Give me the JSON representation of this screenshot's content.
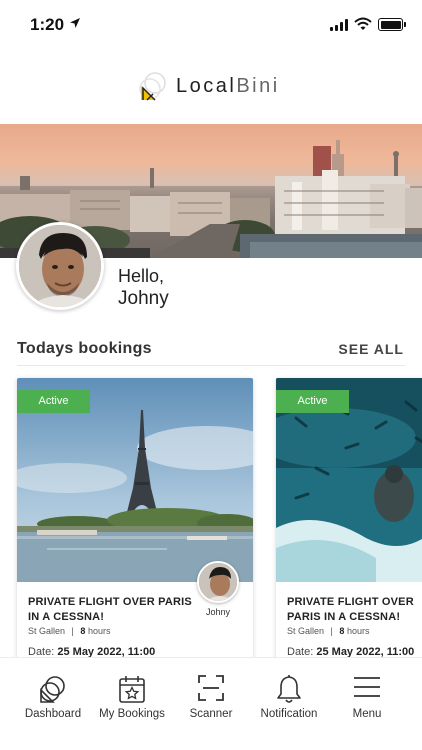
{
  "status_bar": {
    "time": "1:20"
  },
  "app": {
    "logo_main": "Local",
    "logo_light": "Bini"
  },
  "profile": {
    "greeting": "Hello,",
    "name": "Johny"
  },
  "bookings": {
    "section_title": "Todays bookings",
    "see_all_label": "SEE ALL",
    "cards": [
      {
        "status": "Active",
        "title": "PRIVATE FLIGHT OVER PARIS IN A CESSNA!",
        "location": "St Gallen",
        "separator": "|",
        "duration_value": "8",
        "duration_unit": "hours",
        "date_label": "Date:",
        "date_value": "25 May 2022, 11:00",
        "guide_name": "Johny"
      },
      {
        "status": "Active",
        "title": "PRIVATE FLIGHT OVER PARIS IN A CESSNA!",
        "location": "St Gallen",
        "separator": "|",
        "duration_value": "8",
        "duration_unit": "hours",
        "date_label": "Date:",
        "date_value": "25 May 2022, 11:00"
      }
    ]
  },
  "bottom_nav": [
    {
      "label": "Dashboard",
      "icon": "dashboard-icon"
    },
    {
      "label": "My Bookings",
      "icon": "calendar-star-icon"
    },
    {
      "label": "Scanner",
      "icon": "scanner-icon"
    },
    {
      "label": "Notification",
      "icon": "bell-icon"
    },
    {
      "label": "Menu",
      "icon": "hamburger-menu-icon"
    }
  ],
  "colors": {
    "active_badge": "#4caf50",
    "logo_accent": "#f2c200"
  }
}
